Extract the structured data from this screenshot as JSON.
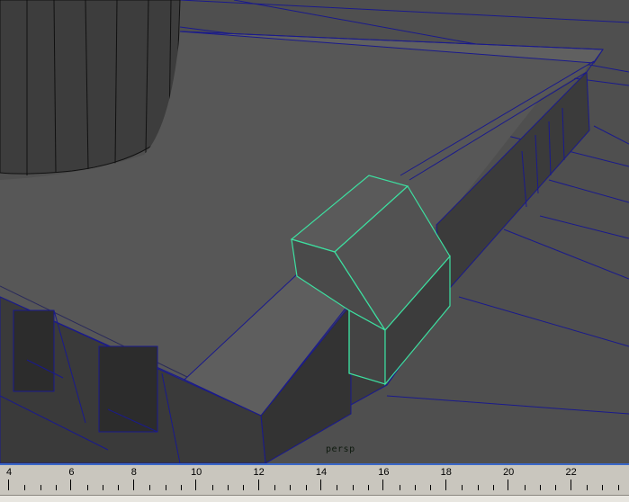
{
  "viewport": {
    "camera_label": "persp",
    "colors": {
      "background": "#4f4f4f",
      "wire": "#1a1a8c",
      "selected": "#3ddfa0"
    }
  },
  "timeslider": {
    "labels": [
      "4",
      "6",
      "8",
      "10",
      "12",
      "14",
      "16",
      "18",
      "20",
      "22"
    ],
    "accent": "#3a67c8"
  }
}
